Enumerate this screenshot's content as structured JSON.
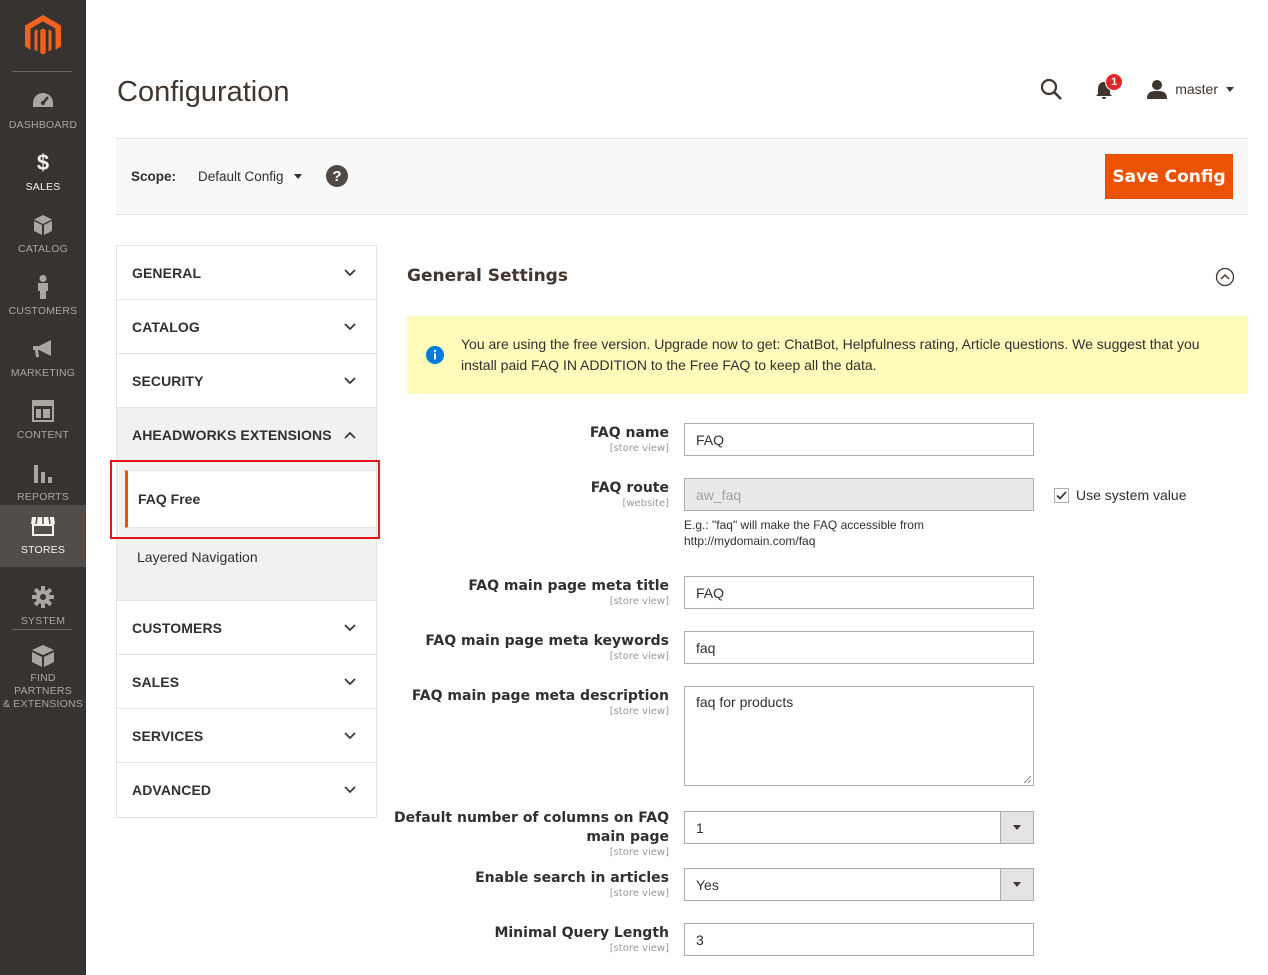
{
  "sidebar": {
    "items": [
      {
        "label": "DASHBOARD",
        "icon": "dashboard-icon"
      },
      {
        "label": "SALES",
        "icon": "dollar-icon"
      },
      {
        "label": "CATALOG",
        "icon": "box-icon"
      },
      {
        "label": "CUSTOMERS",
        "icon": "person-icon"
      },
      {
        "label": "MARKETING",
        "icon": "megaphone-icon"
      },
      {
        "label": "CONTENT",
        "icon": "layout-icon"
      },
      {
        "label": "REPORTS",
        "icon": "bar-chart-icon"
      },
      {
        "label": "STORES",
        "icon": "store-icon"
      },
      {
        "label": "SYSTEM",
        "icon": "gear-icon"
      },
      {
        "label": "FIND PARTNERS\n& EXTENSIONS",
        "label_1": "FIND PARTNERS",
        "label_2": "& EXTENSIONS",
        "icon": "partners-box-icon"
      }
    ],
    "active": "STORES"
  },
  "header": {
    "title": "Configuration",
    "notification_count": "1",
    "username": "master"
  },
  "scope": {
    "label": "Scope:",
    "value": "Default Config",
    "help": "?",
    "save_label": "Save Config"
  },
  "config_nav": {
    "sections": [
      {
        "title": "GENERAL"
      },
      {
        "title": "CATALOG"
      },
      {
        "title": "SECURITY"
      },
      {
        "title": "AHEADWORKS EXTENSIONS"
      },
      {
        "title": "CUSTOMERS"
      },
      {
        "title": "SALES"
      },
      {
        "title": "SERVICES"
      },
      {
        "title": "ADVANCED"
      }
    ],
    "sub_items": [
      {
        "label": "FAQ Free"
      },
      {
        "label": "Layered Navigation"
      }
    ]
  },
  "main": {
    "section_title": "General Settings",
    "notice": "You are using the free version. Upgrade now to get: ChatBot, Helpfulness rating, Article questions. We suggest that you install paid FAQ IN ADDITION to the Free FAQ to keep all the data.",
    "fields": {
      "faq_name": {
        "label": "FAQ name",
        "scope": "[store view]",
        "value": "FAQ"
      },
      "faq_route": {
        "label": "FAQ route",
        "scope": "[website]",
        "value": "aw_faq",
        "note_1": "E.g.: \"faq\" will make the FAQ accessible from",
        "note_2": "http://mydomain.com/faq",
        "use_system": "Use system value"
      },
      "meta_title": {
        "label": "FAQ main page meta title",
        "scope": "[store view]",
        "value": "FAQ"
      },
      "meta_keywords": {
        "label": "FAQ main page meta keywords",
        "scope": "[store view]",
        "value": "faq"
      },
      "meta_description": {
        "label": "FAQ main page meta description",
        "scope": "[store view]",
        "value": "faq for products"
      },
      "columns": {
        "label_1": "Default number of columns on FAQ",
        "label_2": "main page",
        "scope": "[store view]",
        "value": "1"
      },
      "search": {
        "label": "Enable search in articles",
        "scope": "[store view]",
        "value": "Yes"
      },
      "min_query": {
        "label": "Minimal Query Length",
        "scope": "[store view]",
        "value": "3"
      }
    }
  },
  "colors": {
    "accent": "#eb5202",
    "sidebar_bg": "#373330",
    "notice_bg": "#fffbbb",
    "highlight": "#e3141c"
  }
}
